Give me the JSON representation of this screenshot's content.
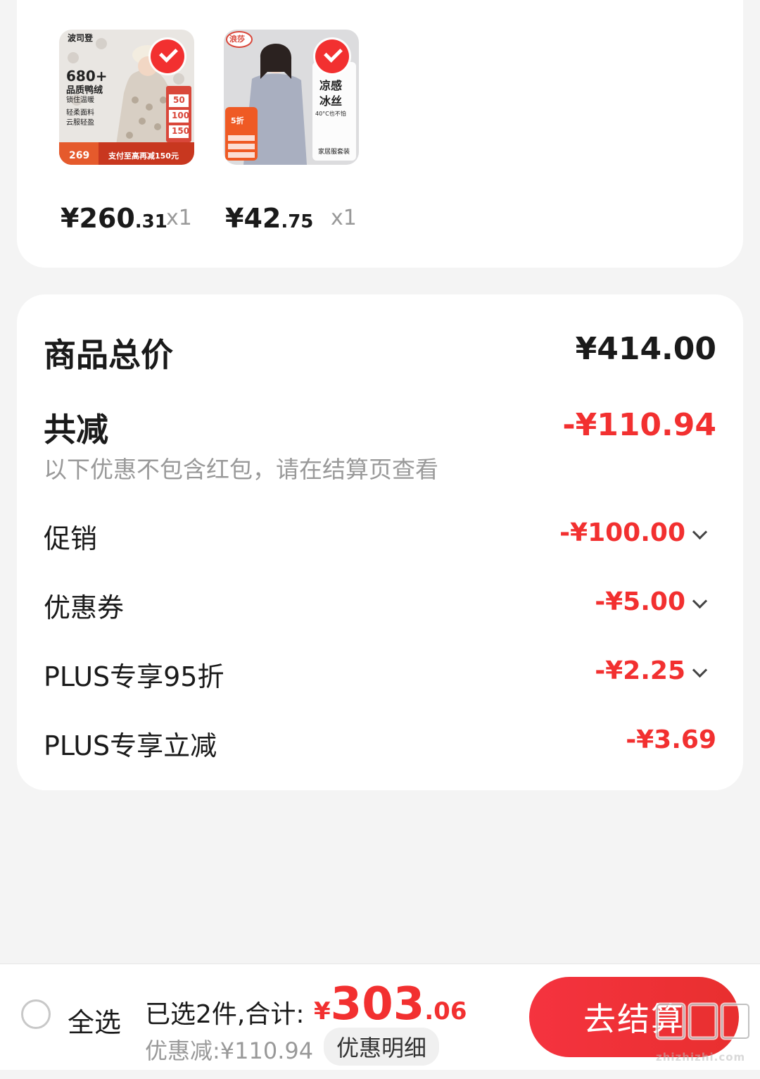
{
  "products": [
    {
      "price_main": "¥260",
      "price_decimal": ".31",
      "quantity": "x1",
      "thumb_text": {
        "brand": "波司登",
        "line1": "680+",
        "line2": "品质鸭绒",
        "line3": "锁住温暖",
        "line4": "轻柔面料",
        "line5": "云服轻盈",
        "coupon_a": "50",
        "coupon_b": "100",
        "coupon_c": "150",
        "price_tag": "269",
        "banner": "支付至高再减150元"
      }
    },
    {
      "price_main": "¥42",
      "price_decimal": ".75",
      "quantity": "x1",
      "thumb_text": {
        "brand": "浪莎",
        "line1": "凉感",
        "line2": "冰丝",
        "line3": "40°C也不怕",
        "badge": "5折",
        "footer": "家居服套装"
      }
    }
  ],
  "summary": {
    "total_label": "商品总价",
    "total_value": "¥414.00",
    "discount_label": "共减",
    "discount_value": "-¥110.94",
    "note": "以下优惠不包含红包，请在结算页查看",
    "rows": [
      {
        "label": "促销",
        "value": "-¥100.00",
        "expandable": true
      },
      {
        "label": "优惠券",
        "value": "-¥5.00",
        "expandable": true
      },
      {
        "label": "PLUS专享95折",
        "value": "-¥2.25",
        "expandable": true
      },
      {
        "label": "PLUS专享立减",
        "value": "-¥3.69",
        "expandable": false
      }
    ]
  },
  "bottom_bar": {
    "select_all_label": "全选",
    "selected_text": "已选2件,合计:",
    "currency": "¥",
    "total_main": "303",
    "total_decimal": ".06",
    "saved_text": "优惠减:¥110.94",
    "details_button": "优惠明细",
    "checkout_button": "去结算"
  },
  "watermark": "值值值",
  "watermark_url": "zhizhizhi.com",
  "colors": {
    "accent_red": "#f23030",
    "background": "#f4f4f4",
    "card": "#ffffff"
  }
}
